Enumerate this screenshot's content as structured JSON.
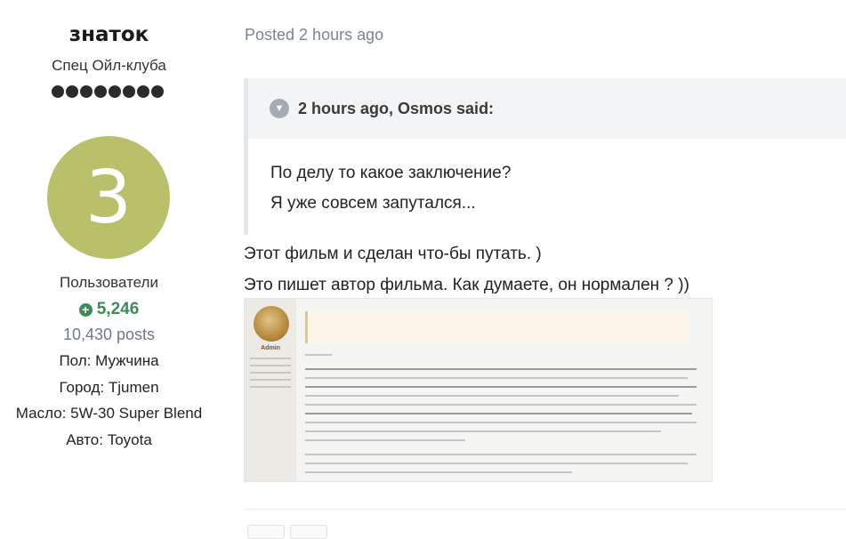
{
  "author": {
    "name": "знаток",
    "title": "Спец Ойл-клуба",
    "pips": 8,
    "avatar_letter": "3",
    "avatar_color": "#b8c06a",
    "group": "Пользователи",
    "reputation": "5,246",
    "reputation_color": "#3d8a5a",
    "posts": "10,430 posts",
    "fields": [
      {
        "label": "Пол:",
        "value": "Мужчина"
      },
      {
        "label": "Город:",
        "value": "Tjumen"
      },
      {
        "label": "Масло:",
        "value": "5W-30 Super Blend"
      },
      {
        "label": "Авто:",
        "value": "Toyota"
      }
    ]
  },
  "post": {
    "meta": "Posted 2 hours ago",
    "quote": {
      "header": "2 hours ago, Osmos said:",
      "lines": [
        "По делу то какое заключение?",
        "Я уже совсем запутался..."
      ]
    },
    "lines": [
      "Этот фильм и сделан что-бы путать. )",
      "Это пишет автор фильма.  Как думаете, он нормален ? ))"
    ],
    "attachment": {
      "icon": "screenshot-image-icon",
      "author_label": "Admin"
    }
  }
}
